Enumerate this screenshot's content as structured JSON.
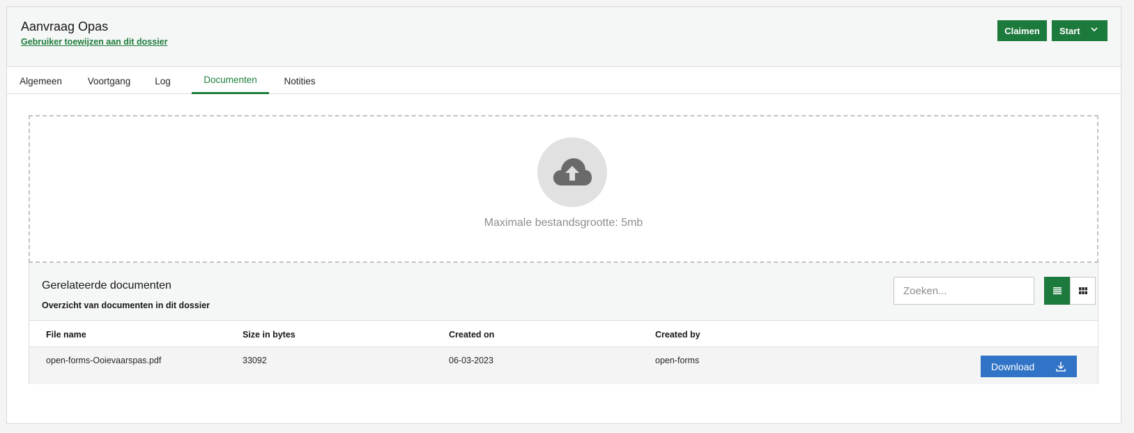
{
  "header": {
    "title": "Aanvraag Opas",
    "assign_link": "Gebruiker toewijzen aan dit dossier",
    "claim_label": "Claimen",
    "start_label": "Start"
  },
  "tabs": [
    {
      "label": "Algemeen",
      "active": false
    },
    {
      "label": "Voortgang",
      "active": false
    },
    {
      "label": "Log",
      "active": false
    },
    {
      "label": "Documenten",
      "active": true
    },
    {
      "label": "Notities",
      "active": false
    }
  ],
  "upload": {
    "icon": "cloud-upload-icon",
    "max_size_text": "Maximale bestandsgrootte: 5mb"
  },
  "documents": {
    "title": "Gerelateerde documenten",
    "subtitle": "Overzicht van documenten in dit dossier",
    "search_placeholder": "Zoeken...",
    "view_mode": "list",
    "columns": [
      "File name",
      "Size in bytes",
      "Created on",
      "Created by"
    ],
    "rows": [
      {
        "file_name": "open-forms-Ooievaarspas.pdf",
        "size": "33092",
        "created_on": "06-03-2023",
        "created_by": "open-forms",
        "action_label": "Download"
      }
    ]
  },
  "colors": {
    "primary_green": "#1d7a3d",
    "download_blue": "#3173c6",
    "background": "#f4f4f4"
  }
}
